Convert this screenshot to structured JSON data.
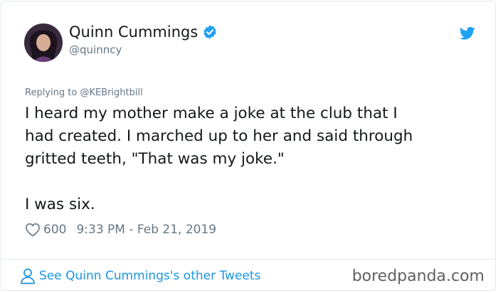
{
  "tweet": {
    "display_name": "Quinn Cummings",
    "handle": "@quinncy",
    "replying_to": "Replying to @KEBrightbill",
    "text": "I heard my mother make a joke at the club that I\nhad created. I marched up to her and said through\ngritted teeth, \"That was my joke.\"\n\nI was six.",
    "likes": "600",
    "timestamp": "9:33 PM - Feb 21, 2019",
    "footer_link": "See Quinn Cummings's other Tweets"
  },
  "watermark": "boredpanda.com",
  "icons": {
    "verified": "verified-badge-icon",
    "bird": "twitter-bird-icon",
    "heart": "heart-icon",
    "user": "user-icon"
  },
  "colors": {
    "accent": "#1da1f2",
    "link": "#1b95e0",
    "muted": "#657786",
    "text": "#14171a",
    "border": "#e1e8ed"
  }
}
